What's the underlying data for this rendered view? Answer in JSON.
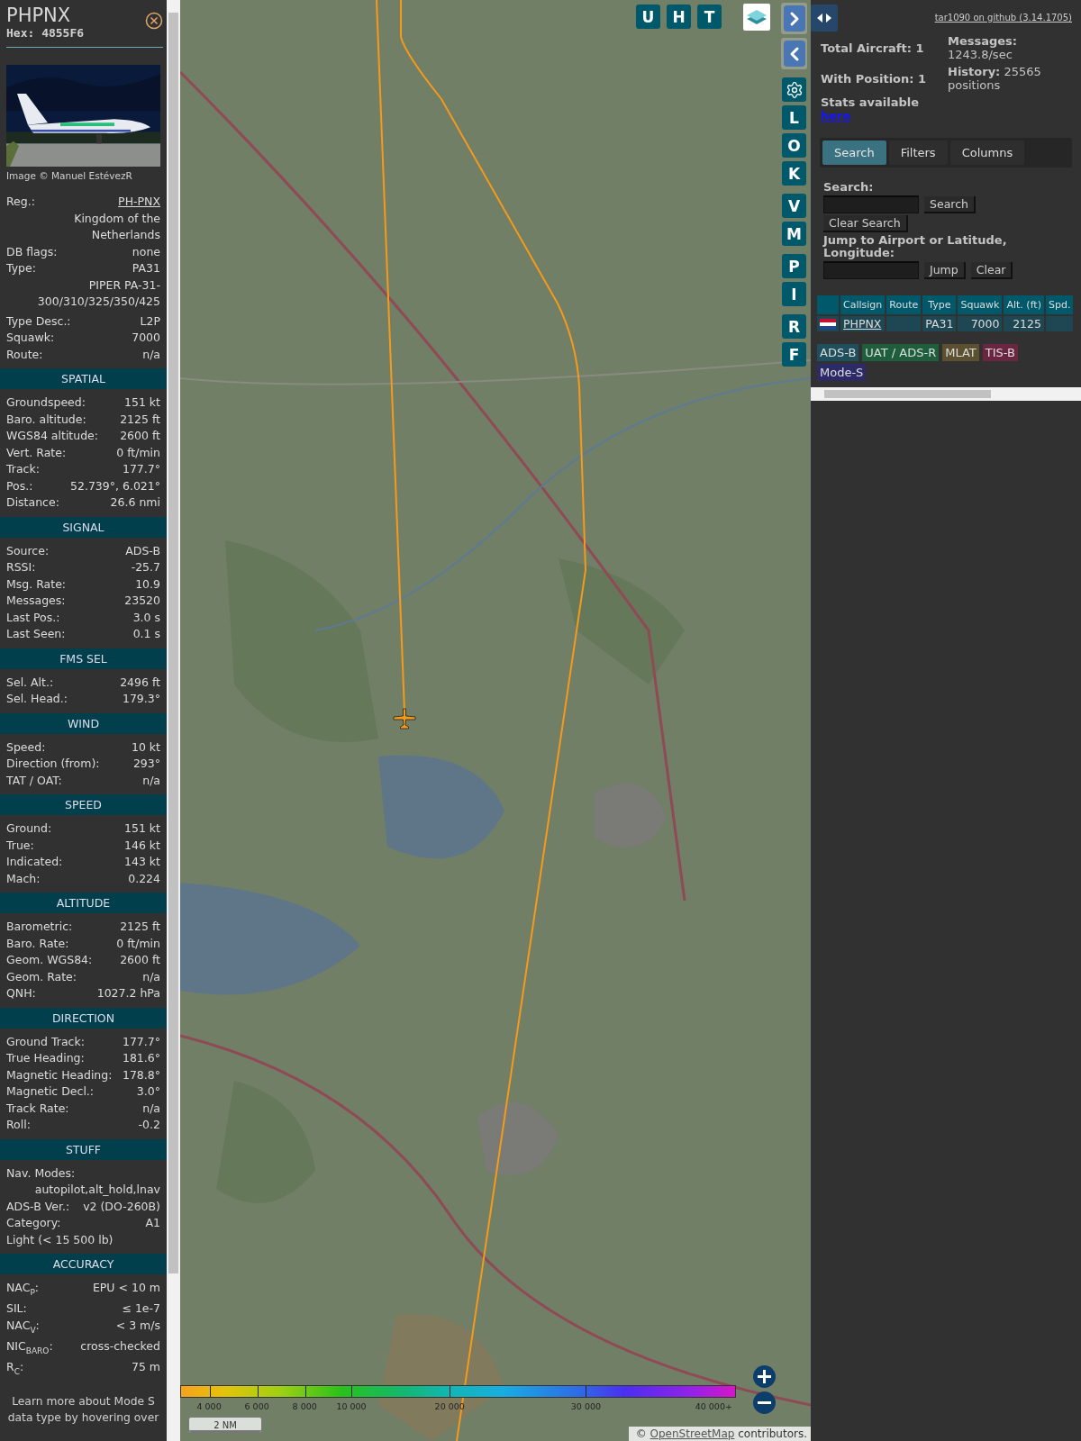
{
  "aircraft_panel": {
    "callsign": "PHPNX",
    "hex": "Hex: 4855F6",
    "photo_credit": "Image © Manuel EstévezR",
    "info_rows": [
      {
        "kind": "link_pair",
        "label": "Reg.:",
        "value": "PH-PNX"
      },
      {
        "kind": "value",
        "value": "Kingdom of the Netherlands"
      },
      {
        "kind": "pair",
        "label": "DB flags:",
        "value": "none"
      },
      {
        "kind": "pair",
        "label": "Type:",
        "value": "PA31"
      },
      {
        "kind": "value",
        "value": "PIPER PA-31-300/310/325/350/425"
      },
      {
        "kind": "pair",
        "label": "Type Desc.:",
        "value": "L2P"
      },
      {
        "kind": "pair",
        "label": "Squawk:",
        "value": "7000"
      },
      {
        "kind": "pair",
        "label": "Route:",
        "value": "n/a"
      }
    ],
    "sections": [
      {
        "title": "SPATIAL",
        "rows": [
          {
            "kind": "pair",
            "label": "Groundspeed:",
            "value": "151 kt"
          },
          {
            "kind": "pair",
            "label": "Baro. altitude:",
            "value": "2125 ft"
          },
          {
            "kind": "pair",
            "label": "WGS84 altitude:",
            "value": "2600 ft"
          },
          {
            "kind": "pair",
            "label": "Vert. Rate:",
            "value": "0 ft/min"
          },
          {
            "kind": "pair",
            "label": "Track:",
            "value": "177.7°"
          },
          {
            "kind": "pair",
            "label": "Pos.:",
            "value": "52.739°, 6.021°"
          },
          {
            "kind": "pair",
            "label": "Distance:",
            "value": "26.6 nmi"
          }
        ]
      },
      {
        "title": "SIGNAL",
        "rows": [
          {
            "kind": "pair",
            "label": "Source:",
            "value": "ADS-B"
          },
          {
            "kind": "pair",
            "label": "RSSI:",
            "value": "-25.7"
          },
          {
            "kind": "pair",
            "label": "Msg. Rate:",
            "value": "10.9"
          },
          {
            "kind": "pair",
            "label": "Messages:",
            "value": "23520"
          },
          {
            "kind": "pair",
            "label": "Last Pos.:",
            "value": "3.0 s"
          },
          {
            "kind": "pair",
            "label": "Last Seen:",
            "value": "0.1 s"
          }
        ]
      },
      {
        "title": "FMS SEL",
        "rows": [
          {
            "kind": "pair",
            "label": "Sel. Alt.:",
            "value": "2496 ft"
          },
          {
            "kind": "pair",
            "label": "Sel. Head.:",
            "value": "179.3°"
          }
        ]
      },
      {
        "title": "WIND",
        "rows": [
          {
            "kind": "pair",
            "label": "Speed:",
            "value": "10 kt"
          },
          {
            "kind": "pair",
            "label": "Direction (from):",
            "value": "293°"
          },
          {
            "kind": "pair",
            "label": "TAT / OAT:",
            "value": "n/a"
          }
        ]
      },
      {
        "title": "SPEED",
        "rows": [
          {
            "kind": "pair",
            "label": "Ground:",
            "value": "151 kt"
          },
          {
            "kind": "pair",
            "label": "True:",
            "value": "146 kt"
          },
          {
            "kind": "pair",
            "label": "Indicated:",
            "value": "143 kt"
          },
          {
            "kind": "pair",
            "label": "Mach:",
            "value": "0.224"
          }
        ]
      },
      {
        "title": "ALTITUDE",
        "rows": [
          {
            "kind": "pair",
            "label": "Barometric:",
            "value": "2125 ft"
          },
          {
            "kind": "pair",
            "label": "Baro. Rate:",
            "value": "0 ft/min"
          },
          {
            "kind": "pair",
            "label": "Geom. WGS84:",
            "value": "2600 ft"
          },
          {
            "kind": "pair",
            "label": "Geom. Rate:",
            "value": "n/a"
          },
          {
            "kind": "pair",
            "label": "QNH:",
            "value": "1027.2 hPa"
          }
        ]
      },
      {
        "title": "DIRECTION",
        "rows": [
          {
            "kind": "pair",
            "label": "Ground Track:",
            "value": "177.7°"
          },
          {
            "kind": "pair",
            "label": "True Heading:",
            "value": "181.6°"
          },
          {
            "kind": "pair",
            "label": "Magnetic Heading:",
            "value": "178.8°"
          },
          {
            "kind": "pair",
            "label": "Magnetic Decl.:",
            "value": "3.0°"
          },
          {
            "kind": "pair",
            "label": "Track Rate:",
            "value": "n/a"
          },
          {
            "kind": "pair",
            "label": "Roll:",
            "value": "-0.2"
          }
        ]
      },
      {
        "title": "STUFF",
        "rows": [
          {
            "kind": "label",
            "label": "Nav. Modes:"
          },
          {
            "kind": "value",
            "value": "autopilot,alt_hold,lnav"
          },
          {
            "kind": "pair",
            "label": "ADS-B Ver.:",
            "value": "v2 (DO-260B)"
          },
          {
            "kind": "pair",
            "label": "Category:",
            "value": "A1"
          },
          {
            "kind": "note",
            "value": "Light (< 15 500 lb)"
          }
        ]
      },
      {
        "title": "ACCURACY",
        "rows": [
          {
            "kind": "pair",
            "label": "NAC$_{P}$:",
            "value": "EPU < 10 m"
          },
          {
            "kind": "pair",
            "label": "SIL:",
            "value": "≤ 1e-7"
          },
          {
            "kind": "pair",
            "label": "NAC$_{V}$:",
            "value": "< 3 m/s"
          },
          {
            "kind": "pair",
            "label": "NIC$_{BARO}$:",
            "value": "cross-checked"
          },
          {
            "kind": "pair",
            "label": "R$_{C}$:",
            "value": "75 m"
          }
        ]
      }
    ],
    "footer": "Learn more about Mode S data type by hovering over"
  },
  "map": {
    "top_buttons": [
      "U",
      "H",
      "T"
    ],
    "side_button_groups": [
      [
        {
          "kind": "next"
        },
        {
          "kind": "prev"
        }
      ],
      [
        {
          "kind": "settings"
        },
        {
          "kind": "letter",
          "label": "L"
        },
        {
          "kind": "letter",
          "label": "O"
        },
        {
          "kind": "letter",
          "label": "K"
        }
      ],
      [
        {
          "kind": "letter",
          "label": "V"
        },
        {
          "kind": "letter",
          "label": "M"
        }
      ],
      [
        {
          "kind": "letter",
          "label": "P"
        },
        {
          "kind": "letter",
          "label": "I"
        }
      ],
      [
        {
          "kind": "letter",
          "label": "R"
        },
        {
          "kind": "letter",
          "label": "F"
        }
      ]
    ],
    "altitude_legend": [
      "4 000",
      "6 000",
      "8 000",
      "10 000",
      "20 000",
      "30 000",
      "40 000+"
    ],
    "scale": "2 NM",
    "attribution": {
      "prefix": "©",
      "link": "OpenStreetMap",
      "suffix": "contributors."
    }
  },
  "side_panel": {
    "version_link": "tar1090 on github (3.14.1705)",
    "stats_left": [
      "Total Aircraft: 1",
      "With Position: 1",
      "Stats available"
    ],
    "stats_link": "here",
    "stats_right": [
      "**Messages:** 1243.8/sec",
      "**History:** 25565 positions"
    ],
    "tabs": [
      {
        "label": "Search",
        "selected": true
      },
      {
        "label": "Filters",
        "selected": false
      },
      {
        "label": "Columns",
        "selected": false
      }
    ],
    "search_label": "Search:",
    "search_button": "Search",
    "clear_search_button": "Clear Search",
    "jump_label": "Jump to Airport or Latitude, Longitude:",
    "jump_button": "Jump",
    "clear_button": "Clear",
    "table": {
      "columns": [
        "Callsign",
        "Route",
        "Type",
        "Squawk",
        "Alt. (ft)",
        "Spd."
      ],
      "rows": [
        {
          "cells": [
            "PHPNX",
            null,
            "PA31",
            "7000",
            "2125",
            null
          ]
        }
      ]
    },
    "source_tags": [
      {
        "label": "ADS-B",
        "color": "#1f4e5c"
      },
      {
        "label": "UAT / ADS-R",
        "color": "#1f5e3c"
      },
      {
        "label": "MLAT",
        "color": "#5b5030"
      },
      {
        "label": "TIS-B",
        "color": "#6a2540"
      },
      {
        "label": "Mode-S",
        "color": "#2c2b68"
      }
    ]
  }
}
